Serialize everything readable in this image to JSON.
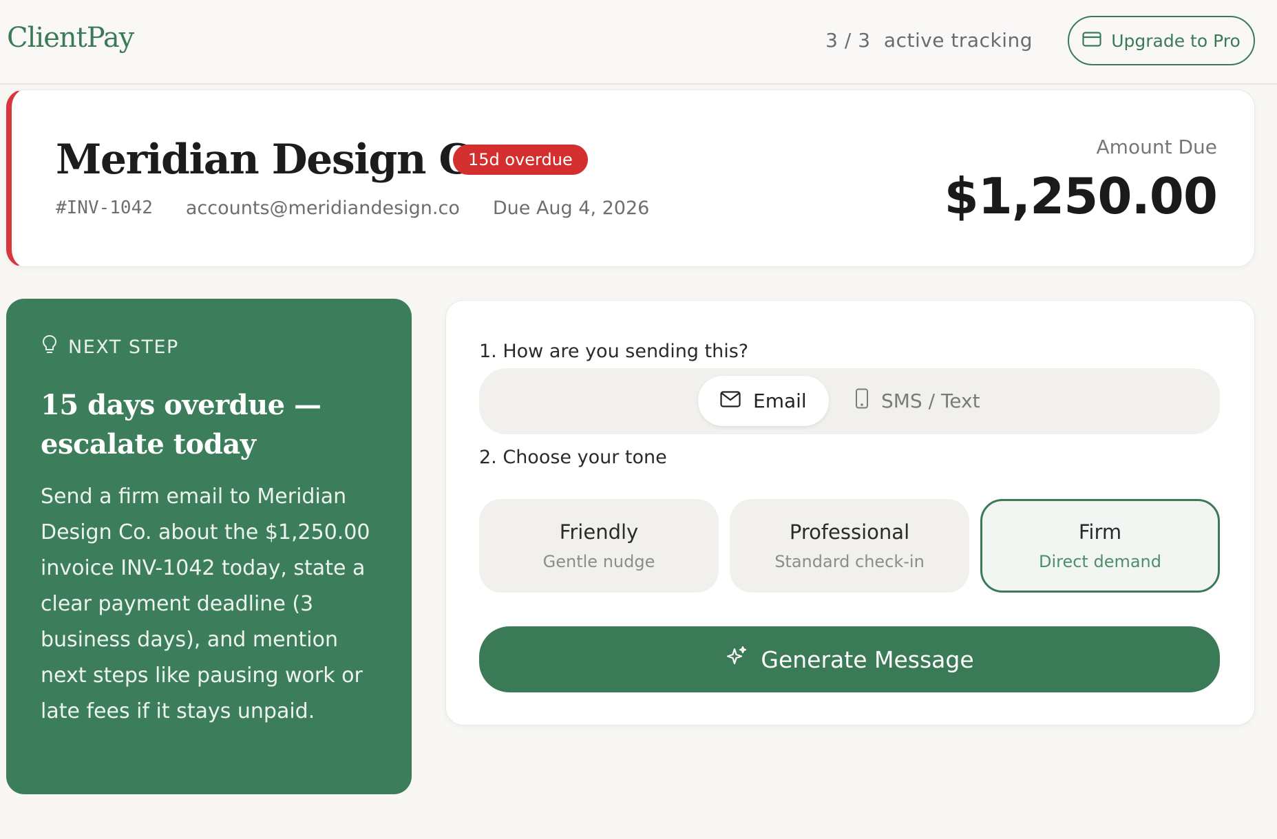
{
  "header": {
    "logo": "ClientPay",
    "tracking_count": "3 / 3",
    "tracking_label": "active tracking",
    "upgrade_label": "Upgrade to Pro"
  },
  "invoice": {
    "client_name": "Meridian Design Co.",
    "overdue_badge": "15d overdue",
    "invoice_number": "#INV-1042",
    "email": "accounts@meridiandesign.co",
    "due_date": "Due Aug 4, 2026",
    "amount_label": "Amount Due",
    "amount": "$1,250.00"
  },
  "next_step": {
    "label": "NEXT STEP",
    "title": "15 days overdue — escalate today",
    "body": "Send a firm email to Meridian Design Co. about the $1,250.00 invoice INV-1042 today, state a clear payment deadline (3 business days), and mention next steps like pausing work or late fees if it stays unpaid."
  },
  "composer": {
    "channel_question": "1. How are you sending this?",
    "channels": [
      {
        "label": "Email",
        "icon": "mail-icon",
        "selected": true
      },
      {
        "label": "SMS / Text",
        "icon": "phone-icon",
        "selected": false
      }
    ],
    "tone_question": "2. Choose your tone",
    "tones": [
      {
        "name": "Friendly",
        "sub": "Gentle nudge",
        "selected": false
      },
      {
        "name": "Professional",
        "sub": "Standard check-in",
        "selected": false
      },
      {
        "name": "Firm",
        "sub": "Direct demand",
        "selected": true
      }
    ],
    "generate_label": "Generate Message"
  },
  "colors": {
    "brand_green": "#3b7a57",
    "overdue_red": "#d32f2f",
    "page_bg": "#f8f7f4"
  }
}
